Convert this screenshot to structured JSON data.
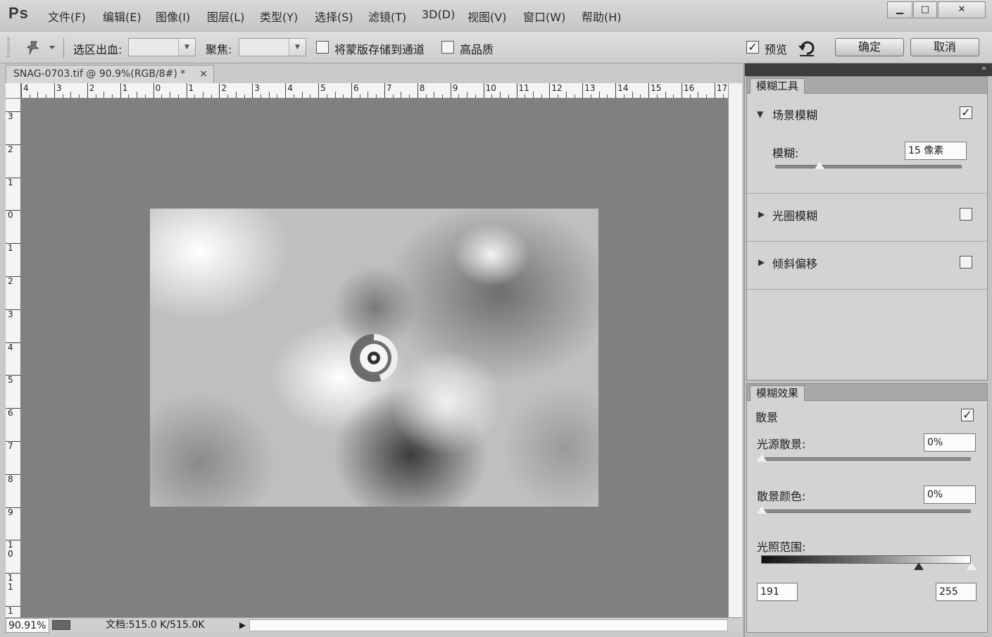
{
  "app": {
    "logo": "Ps"
  },
  "menu": [
    "文件(F)",
    "编辑(E)",
    "图像(I)",
    "图层(L)",
    "类型(Y)",
    "选择(S)",
    "滤镜(T)",
    "3D(D)",
    "视图(V)",
    "窗口(W)",
    "帮助(H)"
  ],
  "window_controls": {
    "minimize": "▁",
    "maximize": "□",
    "close": "✕"
  },
  "options": {
    "selection_bleed_label": "选区出血:",
    "selection_bleed_value": "",
    "focus_label": "聚焦:",
    "focus_value": "",
    "save_mask_label": "将蒙版存储到通道",
    "save_mask_checked": false,
    "high_quality_label": "高品质",
    "high_quality_checked": false,
    "preview_label": "预览",
    "preview_checked": true,
    "ok_label": "确定",
    "cancel_label": "取消"
  },
  "document": {
    "tab_title": "SNAG-0703.tif @ 90.9%(RGB/8#) *",
    "close": "×",
    "hruler": [
      "4",
      "3",
      "2",
      "1",
      "0",
      "1",
      "2",
      "3",
      "4",
      "5",
      "6",
      "7",
      "8",
      "9",
      "10",
      "11",
      "12",
      "13",
      "14",
      "15",
      "16",
      "17"
    ],
    "vruler": [
      "3",
      "2",
      "1",
      "0",
      "1",
      "2",
      "3",
      "4",
      "5",
      "6",
      "7",
      "8",
      "9",
      "1\n0",
      "1\n1",
      "1"
    ]
  },
  "status": {
    "zoom": "90.91%",
    "doc_info": "文档:515.0 K/515.0K",
    "arrow": "▶"
  },
  "panel_dock": {
    "collapse": "»"
  },
  "blur_tools": {
    "tab": "模糊工具",
    "field_blur": {
      "title": "场景模糊",
      "checked": true,
      "blur_label": "模糊:",
      "blur_value": "15 像素",
      "slider": 0.24
    },
    "iris_blur": {
      "title": "光圈模糊",
      "checked": false
    },
    "tilt_shift": {
      "title": "倾斜偏移",
      "checked": false
    }
  },
  "blur_effects": {
    "tab": "模糊效果",
    "bokeh_label": "散景",
    "bokeh_checked": true,
    "light_bokeh_label": "光源散景:",
    "light_bokeh_value": "0%",
    "bokeh_color_label": "散景颜色:",
    "bokeh_color_value": "0%",
    "light_range_label": "光照范围:",
    "light_range_low": "191",
    "light_range_high": "255"
  }
}
